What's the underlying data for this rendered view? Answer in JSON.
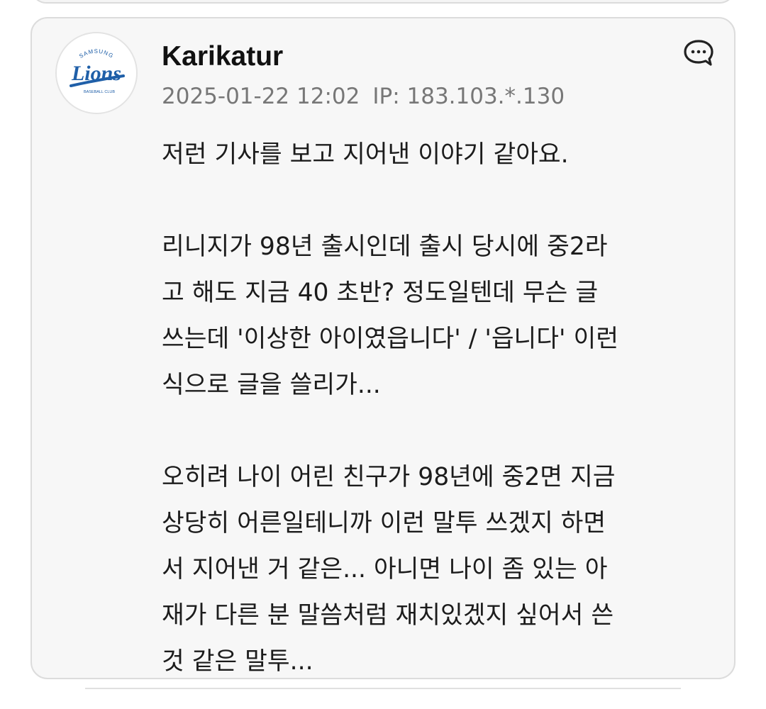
{
  "comment": {
    "username": "Karikatur",
    "date": "2025-01-22 12:02",
    "ip": "IP: 183.103.*.130",
    "avatar": {
      "icon": "lions-logo-icon",
      "text": "Lions",
      "arc_text": "SAMSUNG",
      "bottom_text": "BASEBALL CLUB",
      "color": "#1f5fa8"
    },
    "reply_icon": "speech-bubble-icon",
    "paragraphs": [
      {
        "lines": [
          "저런 기사를 보고 지어낸 이야기 같아요."
        ]
      },
      {
        "lines": [
          "리니지가 98년 출시인데 출시 당시에 중2라",
          "고 해도 지금 40 초반? 정도일텐데 무슨 글",
          "쓰는데 '이상한 아이였읍니다' / '읍니다' 이런",
          "식으로 글을 쓸리가..."
        ]
      },
      {
        "lines": [
          "오히려 나이 어린 친구가 98년에 중2면 지금",
          "상당히 어른일테니까 이런 말투 쓰겠지 하면",
          "서 지어낸 거 같은... 아니면 나이 좀 있는 아",
          "재가 다른 분 말씀처럼 재치있겠지 싶어서 쓴",
          "것 같은 말투..."
        ]
      }
    ]
  }
}
